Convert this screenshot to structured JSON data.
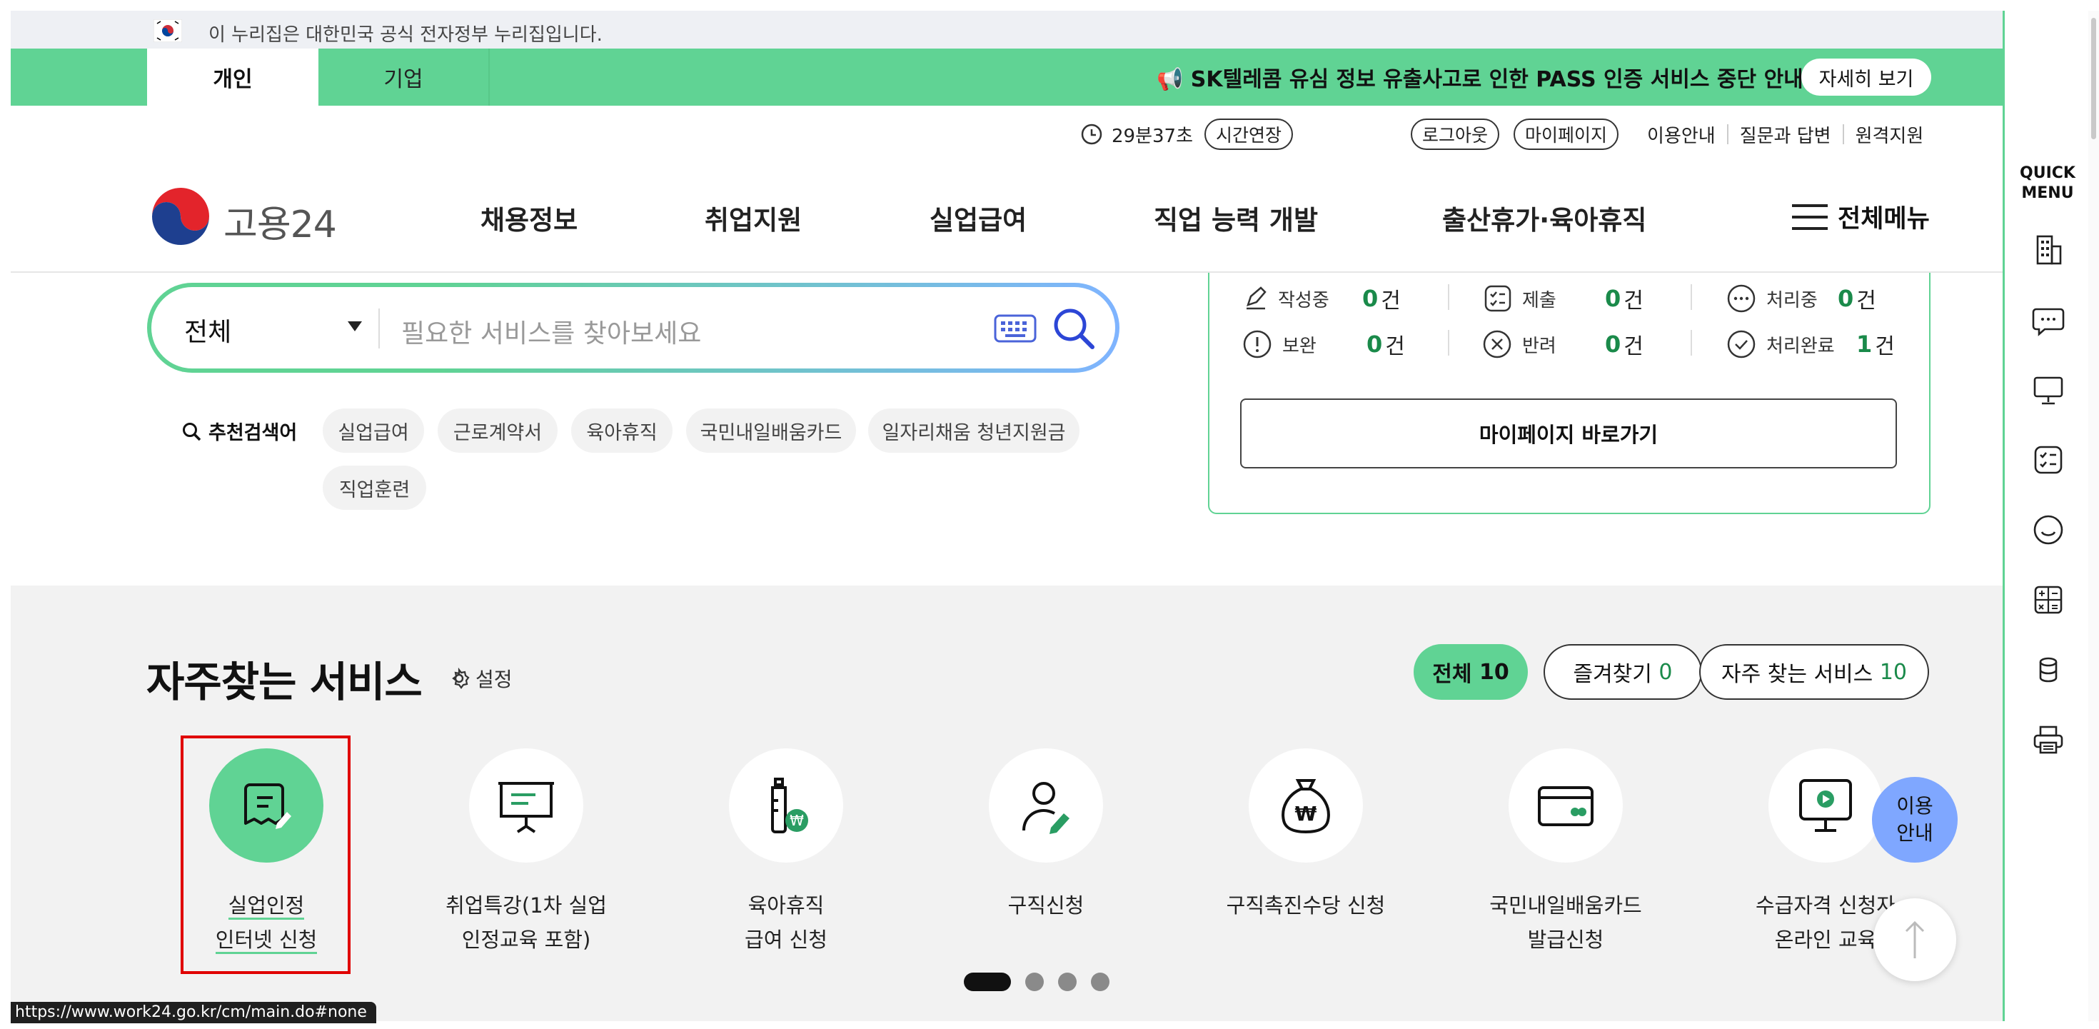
{
  "gov_banner": {
    "text": "이 누리집은 대한민국 공식 전자정부 누리집입니다."
  },
  "top_tabs": [
    "개인",
    "기업"
  ],
  "notice": {
    "text": "📢 SK텔레콤 유심 정보 유출사고로 인한 PASS 인증 서비스 중단 안내",
    "more_button": "자세히 보기"
  },
  "utility": {
    "timer": "29분37초",
    "extend": "시간연장",
    "logout": "로그아웃",
    "mypage": "마이페이지",
    "links": [
      "이용안내",
      "질문과 답변",
      "원격지원"
    ]
  },
  "logo": {
    "text": "고용24"
  },
  "nav": [
    "채용정보",
    "취업지원",
    "실업급여",
    "직업 능력 개발",
    "출산휴가·육아휴직"
  ],
  "all_menu": "전체메뉴",
  "search": {
    "category": "전체",
    "placeholder": "필요한 서비스를 찾아보세요"
  },
  "recommended": {
    "label": "추천검색어",
    "terms": [
      "실업급여",
      "근로계약서",
      "육아휴직",
      "국민내일배움카드",
      "일자리채움 청년지원금",
      "직업훈련"
    ]
  },
  "status_panel": {
    "items": [
      {
        "label": "작성중",
        "count": "0",
        "unit": "건"
      },
      {
        "label": "제출",
        "count": "0",
        "unit": "건"
      },
      {
        "label": "처리중",
        "count": "0",
        "unit": "건"
      },
      {
        "label": "보완",
        "count": "0",
        "unit": "건"
      },
      {
        "label": "반려",
        "count": "0",
        "unit": "건"
      },
      {
        "label": "처리완료",
        "count": "1",
        "unit": "건"
      }
    ],
    "mypage_button": "마이페이지 바로가기"
  },
  "services": {
    "title": "자주찾는 서비스",
    "settings": "설정",
    "filters": [
      {
        "label": "전체",
        "count": "10"
      },
      {
        "label": "즐겨찾기",
        "count": "0"
      },
      {
        "label": "자주 찾는 서비스",
        "count": "10"
      }
    ],
    "items": [
      {
        "line1": "실업인정",
        "line2": "인터넷 신청",
        "icon": "document-edit-icon"
      },
      {
        "line1": "취업특강(1차 실업",
        "line2": "인정교육 포함)",
        "icon": "presentation-board-icon"
      },
      {
        "line1": "육아휴직",
        "line2": "급여 신청",
        "icon": "baby-bottle-won-icon"
      },
      {
        "line1": "구직신청",
        "line2": "",
        "icon": "person-edit-icon"
      },
      {
        "line1": "구직촉진수당 신청",
        "line2": "",
        "icon": "money-bag-won-icon"
      },
      {
        "line1": "국민내일배움카드",
        "line2": "발급신청",
        "icon": "card-icon"
      },
      {
        "line1": "수급자격 신청자",
        "line2": "온라인 교육",
        "icon": "monitor-play-icon"
      }
    ],
    "carousel": {
      "pages": 4,
      "current": 1
    }
  },
  "quick_menu": {
    "title": "QUICK\nMENU",
    "icons": [
      "building-icon",
      "chat-icon",
      "monitor-icon",
      "checklist-icon",
      "smile-icon",
      "calculator-icon",
      "coins-icon",
      "printer-icon"
    ]
  },
  "guide_button": "이용\n안내",
  "status_bar": "https://www.work24.go.kr/cm/main.do#none",
  "colors": {
    "accent": "#60d394",
    "accent_dark": "#1a8a4a",
    "highlight": "#e00000",
    "guide": "#7fa7ff"
  }
}
